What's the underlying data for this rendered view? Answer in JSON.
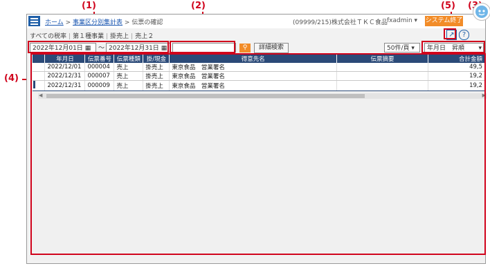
{
  "callouts": {
    "c1": "(1)",
    "c2": "(2)",
    "c3": "(3)",
    "c4": "(4)",
    "c5": "(5)"
  },
  "header": {
    "breadcrumb_home": "ホーム",
    "breadcrumb_sep1": ">",
    "breadcrumb_plan": "事業区分別集計表",
    "breadcrumb_sep2": ">",
    "breadcrumb_current": "伝票の確認",
    "company": "(09999/215)株式会社ＴＫＣ食品",
    "user": "fxadmin ▾",
    "exit_label": "システム終了"
  },
  "subheader": {
    "items": [
      "すべての税率",
      "第１種事業",
      "掛売上",
      "売上２"
    ]
  },
  "toolbar": {
    "date_from": "2022年12月01日",
    "date_sep": "～",
    "date_to": "2022年12月31日",
    "search_value": "",
    "detail_search_label": "詳細検索",
    "page_size": "50件/頁 ▾",
    "sort_value": "年月日　昇順"
  },
  "table": {
    "columns": [
      "年月日",
      "伝票番号",
      "伝票種類",
      "掛/現金",
      "得意先名",
      "伝票摘要",
      "合計金額"
    ],
    "rows": [
      [
        "2022/12/01",
        "000004",
        "売上",
        "掛売上",
        "東京食品　営業署名",
        "",
        "49,5"
      ],
      [
        "2022/12/31",
        "000007",
        "売上",
        "掛売上",
        "東京食品　営業署名",
        "",
        "19,2"
      ],
      [
        "2022/12/31",
        "000009",
        "売上",
        "掛売上",
        "東京食品　営業署名",
        "",
        "19,2"
      ]
    ]
  },
  "colors": {
    "accent_orange": "#f28c28",
    "header_navy": "#2b4a78",
    "menu_blue": "#1f5fa8",
    "callout_red": "#d0021b"
  },
  "icons": {
    "menu": "hamburger-icon",
    "calendar": "calendar-icon",
    "search": "search-icon",
    "export": "export-icon",
    "help": "help-icon",
    "assistant": "assistant-icon"
  }
}
